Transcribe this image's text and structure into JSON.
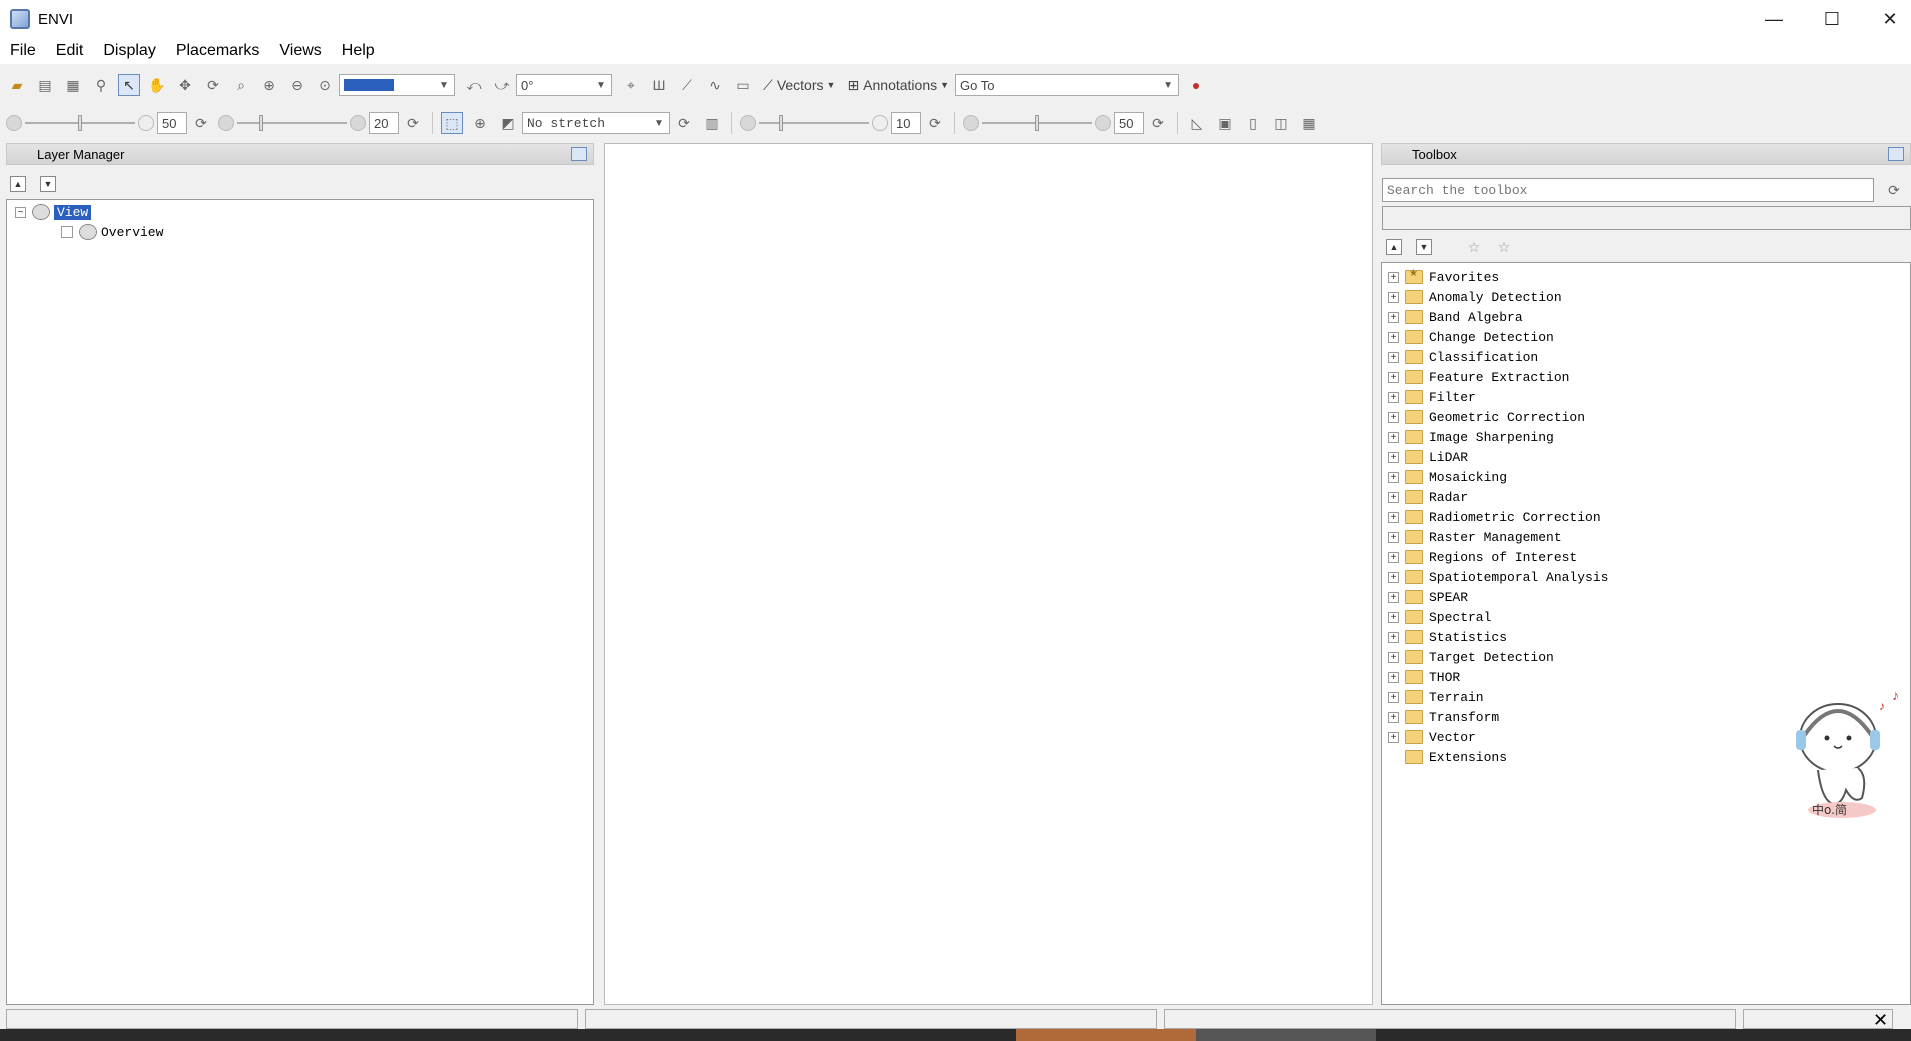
{
  "window": {
    "title": "ENVI"
  },
  "menu": [
    "File",
    "Edit",
    "Display",
    "Placemarks",
    "Views",
    "Help"
  ],
  "toolbar1": {
    "rotation_value": "0°",
    "vectors_label": "Vectors",
    "annotations_label": "Annotations",
    "goto_placeholder": "Go To"
  },
  "toolbar2": {
    "brightness": "50",
    "contrast": "20",
    "stretch": "No stretch",
    "sharpen": "10",
    "transparency": "50"
  },
  "layer_manager": {
    "title": "Layer Manager",
    "tree": [
      {
        "label": "View",
        "selected": true
      },
      {
        "label": "Overview"
      }
    ]
  },
  "toolbox": {
    "title": "Toolbox",
    "search_placeholder": "Search the toolbox",
    "items": [
      "Favorites",
      "Anomaly Detection",
      "Band Algebra",
      "Change Detection",
      "Classification",
      "Feature Extraction",
      "Filter",
      "Geometric Correction",
      "Image Sharpening",
      "LiDAR",
      "Mosaicking",
      "Radar",
      "Radiometric Correction",
      "Raster Management",
      "Regions of Interest",
      "Spatiotemporal Analysis",
      "SPEAR",
      "Spectral",
      "Statistics",
      "Target Detection",
      "THOR",
      "Terrain",
      "Transform",
      "Vector",
      "Extensions"
    ]
  }
}
